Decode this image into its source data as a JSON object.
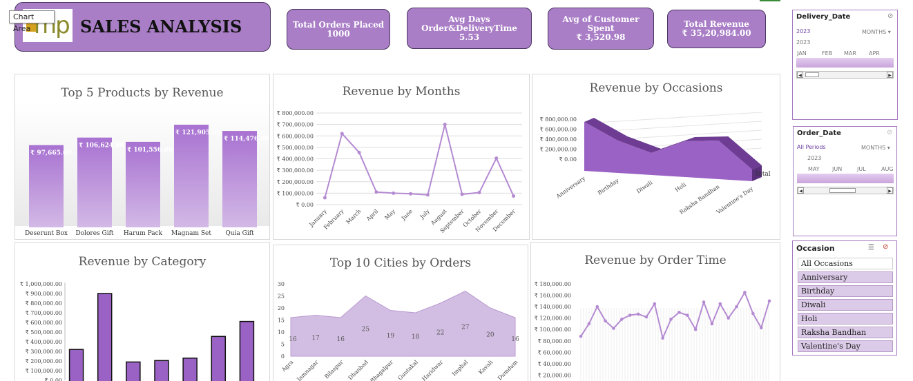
{
  "tooltip": "Chart Area",
  "header": {
    "logo_text": "mp",
    "title": "SALES ANALYSIS"
  },
  "kpis": [
    {
      "label": "Total Orders Placed",
      "value": "1000"
    },
    {
      "label": "Avg Days Order&DeliveryTime",
      "value": "5.53"
    },
    {
      "label": "Avg of Customer Spent",
      "value": "₹ 3,520.98"
    },
    {
      "label": "Total Revenue",
      "value": "₹ 35,20,984.00"
    }
  ],
  "panels": {
    "top5": "Top 5 Products by Revenue",
    "months": "Revenue by Months",
    "occasions": "Revenue by Occasions",
    "category": "Revenue by Category",
    "cities": "Top 10 Cities by Orders",
    "ordertime": "Revenue by Order Time"
  },
  "chart_data": [
    {
      "id": "top5",
      "type": "bar",
      "title": "Top 5 Products by Revenue",
      "categories": [
        "Deserunt Box",
        "Dolores Gift",
        "Harum Pack",
        "Magnam Set",
        "Quia Gift"
      ],
      "values": [
        97665,
        106624,
        101556,
        121905,
        114476
      ],
      "data_labels": [
        "₹ 97,665.00",
        "₹ 106,624.00",
        "₹ 101,556.00",
        "₹ 121,905.00",
        "₹ 114,476.00"
      ],
      "ylim": [
        0,
        135000
      ]
    },
    {
      "id": "months",
      "type": "line",
      "title": "Revenue by Months",
      "categories": [
        "January",
        "February",
        "March",
        "April",
        "May",
        "June",
        "July",
        "August",
        "September",
        "October",
        "November",
        "December"
      ],
      "values": [
        60000,
        620000,
        455000,
        110000,
        100000,
        95000,
        85000,
        700000,
        90000,
        105000,
        405000,
        75000
      ],
      "y_ticks": [
        "₹ 0.00",
        "₹ 100,000.00",
        "₹ 200,000.00",
        "₹ 300,000.00",
        "₹ 400,000.00",
        "₹ 500,000.00",
        "₹ 600,000.00",
        "₹ 700,000.00",
        "₹ 800,000.00"
      ],
      "ylim": [
        0,
        800000
      ],
      "grid": true
    },
    {
      "id": "occasions",
      "type": "area",
      "title": "Revenue by Occasions",
      "categories": [
        "Anniversary",
        "Birthday",
        "Diwali",
        "Holi",
        "Raksha Bandhan",
        "Valentine's Day"
      ],
      "series": [
        {
          "name": "Total",
          "values": [
            710000,
            470000,
            320000,
            520000,
            560000,
            170000
          ]
        }
      ],
      "y_ticks": [
        "₹ 0.00",
        "₹ 200,000.00",
        "₹ 400,000.00",
        "₹ 600,000.00",
        "₹ 800,000.00"
      ],
      "ylim": [
        0,
        800000
      ]
    },
    {
      "id": "category",
      "type": "bar",
      "title": "Revenue by Category",
      "values": [
        320000,
        900000,
        190000,
        205000,
        230000,
        455000,
        610000
      ],
      "y_ticks": [
        "₹ 0.00",
        "₹ 100,000.00",
        "₹ 200,000.00",
        "₹ 300,000.00",
        "₹ 400,000.00",
        "₹ 500,000.00",
        "₹ 600,000.00",
        "₹ 700,000.00",
        "₹ 800,000.00",
        "₹ 900,000.00",
        "₹ 1,000,000.00"
      ],
      "ylim": [
        0,
        1000000
      ]
    },
    {
      "id": "cities",
      "type": "area",
      "title": "Top 10 Cities by Orders",
      "categories": [
        "Agra",
        "Jamnagar",
        "Bilaspur",
        "Dhanbad",
        "Bhagalpur",
        "Guntakal",
        "Haridwar",
        "Imphal",
        "Kavali",
        "Dumdum"
      ],
      "values": [
        16,
        17,
        16,
        25,
        19,
        18,
        22,
        27,
        20,
        16
      ],
      "y_ticks": [
        "0",
        "5",
        "10",
        "15",
        "20",
        "25",
        "30"
      ],
      "ylim": [
        0,
        30
      ]
    },
    {
      "id": "ordertime",
      "type": "line",
      "title": "Revenue by Order Time",
      "values": [
        88000,
        110000,
        140000,
        115000,
        102000,
        118000,
        125000,
        127000,
        122000,
        145000,
        85000,
        118000,
        130000,
        125000,
        100000,
        148000,
        110000,
        145000,
        120000,
        140000,
        165000,
        128000,
        103000,
        150000
      ],
      "y_ticks": [
        "₹ 20,000.00",
        "₹ 40,000.00",
        "₹ 60,000.00",
        "₹ 80,000.00",
        "₹ 100,000.00",
        "₹ 120,000.00",
        "₹ 140,000.00",
        "₹ 160,000.00",
        "₹ 180,000.00"
      ],
      "ylim": [
        0,
        180000
      ]
    }
  ],
  "slicers": {
    "delivery": {
      "title": "Delivery_Date",
      "selection": "2023",
      "level": "MONTHS",
      "year": "2023",
      "months": [
        "JAN",
        "FEB",
        "MAR",
        "APR"
      ]
    },
    "order": {
      "title": "Order_Date",
      "selection": "All Periods",
      "level": "MONTHS",
      "year": "2023",
      "months": [
        "MAY",
        "JUN",
        "JUL",
        "AUG"
      ]
    },
    "occasion": {
      "title": "Occasion",
      "items": [
        "All Occasions",
        "Anniversary",
        "Birthday",
        "Diwali",
        "Holi",
        "Raksha Bandhan",
        "Valentine's Day"
      ]
    }
  },
  "colors": {
    "accent": "#a97ec6",
    "line": "#b48ad2",
    "bar": "#9a62c4",
    "area": "#d3bee3"
  }
}
